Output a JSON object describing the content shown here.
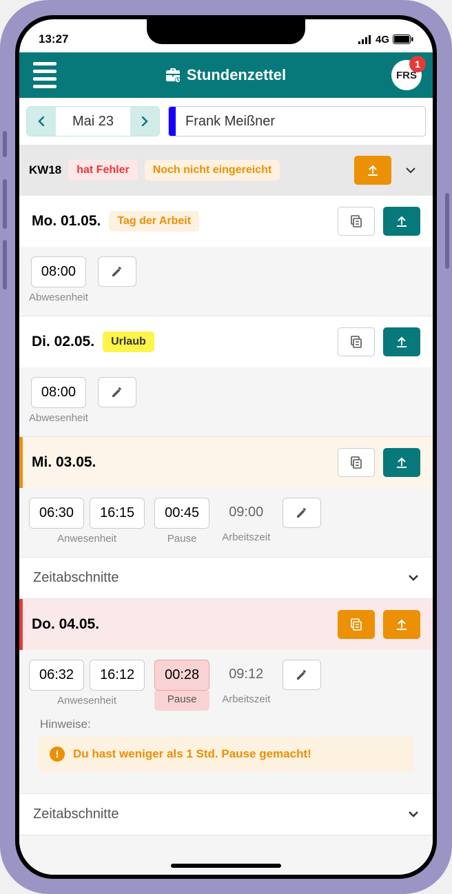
{
  "status": {
    "time": "13:27",
    "net": "4G"
  },
  "header": {
    "title": "Stundenzettel",
    "avatar_initials": "FRS",
    "avatar_badge": "1"
  },
  "nav": {
    "month": "Mai 23",
    "user": "Frank Meißner"
  },
  "week": {
    "label": "KW18",
    "tag_error": "hat Fehler",
    "tag_pending": "Noch nicht eingereicht"
  },
  "days": [
    {
      "date": "Mo. 01.05.",
      "tag": "Tag der Arbeit",
      "absence_time": "08:00",
      "absence_label": "Abwesenheit"
    },
    {
      "date": "Di. 02.05.",
      "tag": "Urlaub",
      "absence_time": "08:00",
      "absence_label": "Abwesenheit"
    },
    {
      "date": "Mi. 03.05.",
      "presence_start": "06:30",
      "presence_end": "16:15",
      "presence_label": "Anwesenheit",
      "pause_time": "00:45",
      "pause_label": "Pause",
      "work_time": "09:00",
      "work_label": "Arbeitszeit",
      "segments_label": "Zeitabschnitte"
    },
    {
      "date": "Do. 04.05.",
      "presence_start": "06:32",
      "presence_end": "16:12",
      "presence_label": "Anwesenheit",
      "pause_time": "00:28",
      "pause_label": "Pause",
      "work_time": "09:12",
      "work_label": "Arbeitszeit",
      "hints_label": "Hinweise:",
      "hint_text": "Du hast weniger als 1 Std. Pause gemacht!",
      "segments_label": "Zeitabschnitte"
    }
  ]
}
